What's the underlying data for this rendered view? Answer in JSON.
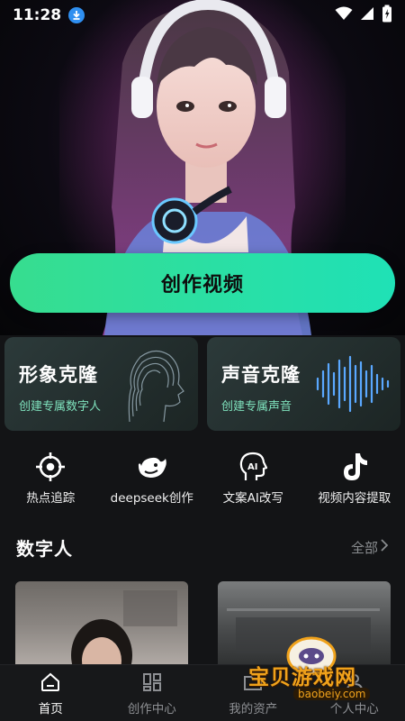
{
  "status": {
    "time": "11:28"
  },
  "hero": {
    "button_label": "创作视频"
  },
  "cards": [
    {
      "title": "形象克隆",
      "subtitle": "创建专属数字人"
    },
    {
      "title": "声音克隆",
      "subtitle": "创建专属声音"
    }
  ],
  "tools": [
    {
      "label": "热点追踪",
      "icon": "crosshair-icon"
    },
    {
      "label": "deepseek创作",
      "icon": "whale-icon"
    },
    {
      "label": "文案AI改写",
      "icon": "ai-head-icon"
    },
    {
      "label": "视频内容提取",
      "icon": "tiktok-icon"
    }
  ],
  "section": {
    "title": "数字人",
    "more": "全部"
  },
  "nav": [
    {
      "label": "首页",
      "icon": "home-icon",
      "active": true
    },
    {
      "label": "创作中心",
      "icon": "grid-icon",
      "active": false
    },
    {
      "label": "我的资产",
      "icon": "folder-icon",
      "active": false
    },
    {
      "label": "个人中心",
      "icon": "person-icon",
      "active": false
    }
  ],
  "watermark": {
    "text": "宝贝游戏网",
    "url": "baobeiy.com"
  },
  "colors": {
    "accent_start": "#37dd8f",
    "accent_end": "#1fe1b6",
    "card_sub": "#7fe2bd",
    "background": "#131416"
  }
}
